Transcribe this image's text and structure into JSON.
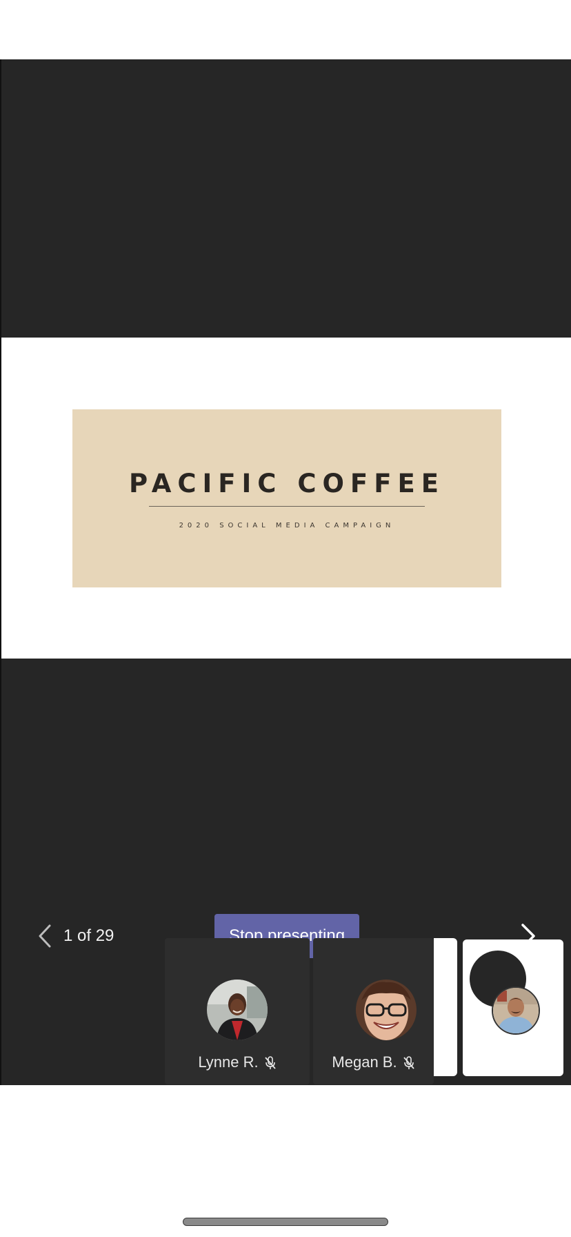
{
  "slide": {
    "title": "PACIFIC COFFEE",
    "subtitle": "2020 SOCIAL MEDIA CAMPAIGN",
    "card_color": "#e7d6b9"
  },
  "controls": {
    "counter": "1 of 29",
    "stop_label": "Stop presenting",
    "prev_icon": "chevron-left-icon",
    "next_icon": "chevron-right-icon",
    "accent": "#6264a7"
  },
  "participants": [
    {
      "name": "Lynne R.",
      "muted": true,
      "icon": "mic-off-icon"
    },
    {
      "name": "Megan B.",
      "muted": true,
      "icon": "mic-off-icon"
    }
  ],
  "colors": {
    "stage_bg": "#262626",
    "tile_bg": "#2d2d2d"
  }
}
